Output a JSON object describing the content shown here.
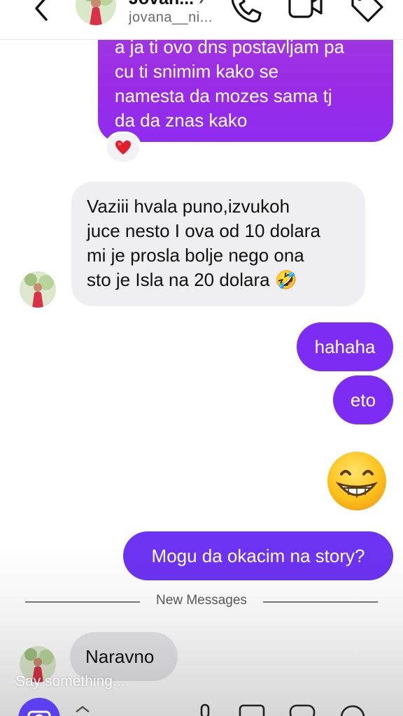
{
  "header": {
    "name": "Jovan...",
    "username": "jovana__ni...",
    "chevron": "›",
    "icons": [
      "back-icon",
      "phone-icon",
      "video-icon",
      "tag-icon"
    ]
  },
  "messages": [
    {
      "direction": "outgoing",
      "text": "a ja ti ovo dns postavljam pa\ncu ti snimim kako se\nnamesta da mozes sama tj\nda da znas kako",
      "reaction": "heart-emoji"
    },
    {
      "direction": "incoming",
      "text": "Vaziii hvala puno,izvukoh\njuce nesto I ova od 10 dolara\nmi je prosla bolje nego ona\nsto je Isla na 20 dolara 🤣"
    },
    {
      "direction": "outgoing",
      "text": "hahaha"
    },
    {
      "direction": "outgoing",
      "text": "eto"
    },
    {
      "direction": "outgoing",
      "emoji": "grinning-face"
    },
    {
      "direction": "outgoing",
      "text": "Mogu da okacim na story?"
    },
    {
      "direction": "incoming",
      "text": "Naravno"
    }
  ],
  "divider": {
    "label": "New Messages"
  },
  "composer": {
    "placeholder": "Say something..."
  },
  "colors": {
    "outgoing_gradient": "#9a2be6",
    "outgoing_violet": "#7d2cf3",
    "incoming_bg": "#efeff1",
    "accent": "#5b3ff0"
  }
}
